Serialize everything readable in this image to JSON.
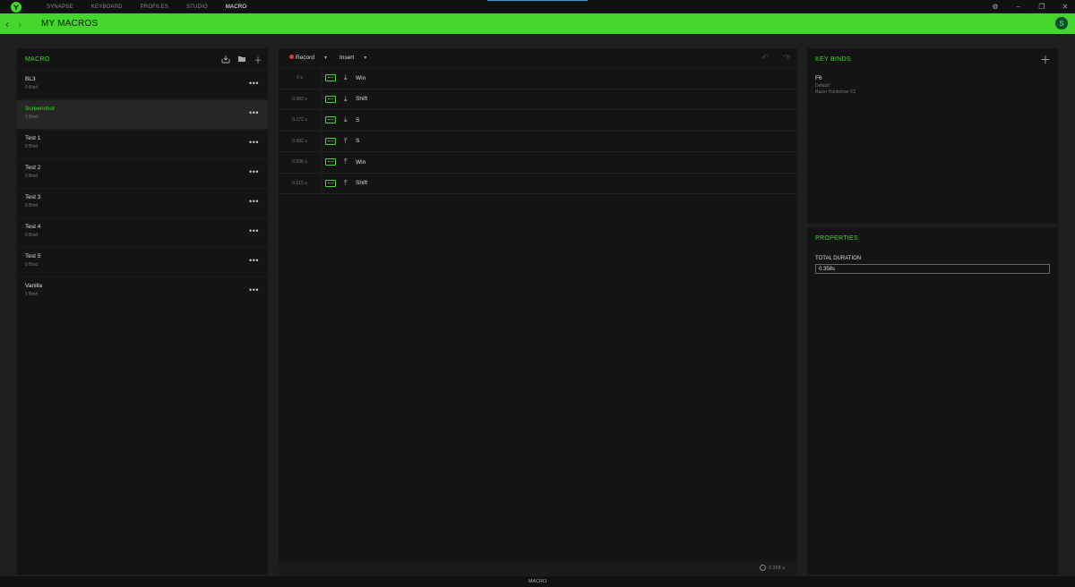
{
  "titlebar": {
    "tabs": [
      "SYNAPSE",
      "KEYBOARD",
      "PROFILES",
      "STUDIO",
      "MACRO"
    ],
    "active_tab": "MACRO",
    "icons": [
      "settings-icon",
      "minimize-icon",
      "restore-icon",
      "close-icon"
    ]
  },
  "header": {
    "back": "‹",
    "forward": "›",
    "title": "MY MACROS",
    "avatar": "S"
  },
  "macro_panel": {
    "title": "MACRO",
    "items": [
      {
        "name": "BL3",
        "binds": "0 Bind"
      },
      {
        "name": "Screenshot",
        "binds": "1 Bind"
      },
      {
        "name": "Test 1",
        "binds": "0 Bind"
      },
      {
        "name": "Test 2",
        "binds": "0 Bind"
      },
      {
        "name": "Test 3",
        "binds": "0 Bind"
      },
      {
        "name": "Test 4",
        "binds": "0 Bind"
      },
      {
        "name": "Test 5",
        "binds": "0 Bind"
      },
      {
        "name": "Vanilla",
        "binds": "1 Bind"
      }
    ],
    "more": "•••"
  },
  "editor": {
    "record": "Record",
    "insert": "Insert",
    "steps": [
      {
        "time": "0 s",
        "dir": "down",
        "key": "Win"
      },
      {
        "time": "0.083 s",
        "dir": "down",
        "key": "Shift"
      },
      {
        "time": "0.172 s",
        "dir": "down",
        "key": "S"
      },
      {
        "time": "0.092 s",
        "dir": "up",
        "key": "S"
      },
      {
        "time": "0.036 s",
        "dir": "up",
        "key": "Win"
      },
      {
        "time": "0.015 s",
        "dir": "up",
        "key": "Shift"
      }
    ],
    "total": "0.358 s"
  },
  "keybinds": {
    "title": "KEY BINDS",
    "key": "F6",
    "profile": "Default",
    "device": "Razer Huntsman V2"
  },
  "properties": {
    "title": "PROPERTIES",
    "label": "TOTAL DURATION",
    "value": "0.358s"
  },
  "bottom": {
    "label": "MACRO"
  }
}
